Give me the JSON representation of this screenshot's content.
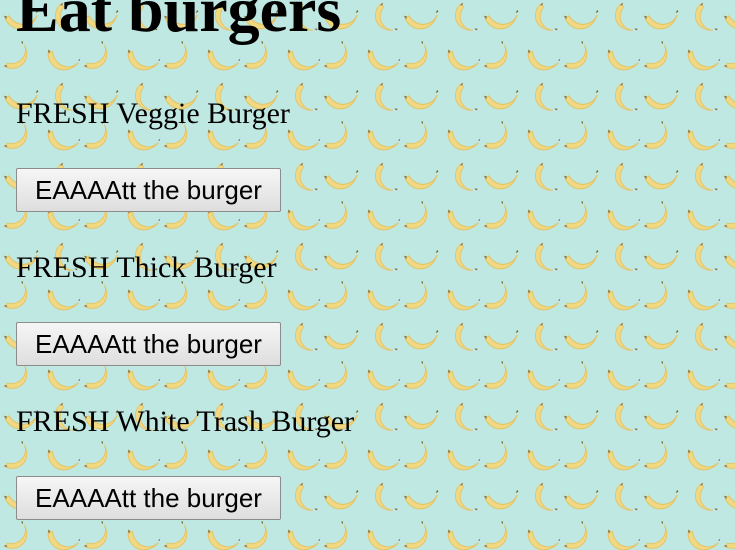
{
  "page": {
    "title": "Eat burgers",
    "background_color": "#bfe8e2",
    "pattern_icon": "banana-icon"
  },
  "burgers": [
    {
      "name": "FRESH Veggie Burger",
      "button_label": "EAAAAtt the burger"
    },
    {
      "name": "FRESH Thick Burger",
      "button_label": "EAAAAtt the burger"
    },
    {
      "name": "FRESH White Trash Burger",
      "button_label": "EAAAAtt the burger"
    }
  ]
}
